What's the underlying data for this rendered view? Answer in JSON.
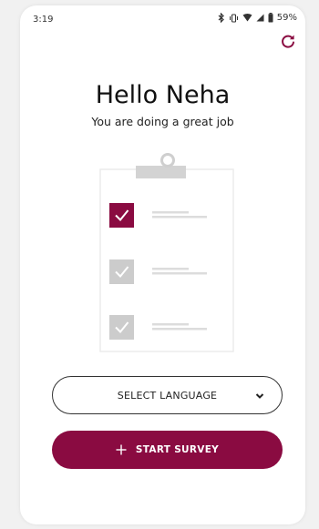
{
  "status_bar": {
    "time": "3:19",
    "battery": "59%",
    "icons": [
      "bluetooth-icon",
      "vibrate-icon",
      "wifi-icon",
      "signal-icon",
      "battery-icon"
    ]
  },
  "header": {
    "refresh_icon": "refresh-icon",
    "greeting": "Hello Neha",
    "subtitle": "You are doing a great job"
  },
  "illustration": {
    "type": "clipboard-checklist",
    "items": [
      {
        "checked": true,
        "color": "#8a0b41"
      },
      {
        "checked": true,
        "color": "#cccccc"
      },
      {
        "checked": true,
        "color": "#cccccc"
      }
    ]
  },
  "actions": {
    "select_language": "SELECT LANGUAGE",
    "start_survey": "START SURVEY"
  },
  "colors": {
    "primary": "#8a0b41",
    "muted": "#cccccc"
  }
}
